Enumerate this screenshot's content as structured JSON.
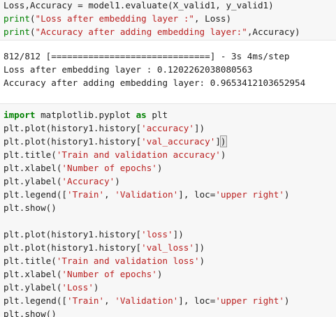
{
  "cell_top": {
    "lines": [
      {
        "segments": [
          {
            "cls": "t-plain",
            "text": "Loss,Accuracy = model1.evaluate(X_valid1, y_valid1)"
          }
        ]
      },
      {
        "segments": [
          {
            "cls": "t-builtin",
            "text": "print"
          },
          {
            "cls": "t-plain",
            "text": "("
          },
          {
            "cls": "t-str",
            "text": "\"Loss after embedding layer :\""
          },
          {
            "cls": "t-plain",
            "text": ", Loss)"
          }
        ]
      },
      {
        "segments": [
          {
            "cls": "t-builtin",
            "text": "print"
          },
          {
            "cls": "t-plain",
            "text": "("
          },
          {
            "cls": "t-str",
            "text": "\"Accuracy after adding embedding layer:\""
          },
          {
            "cls": "t-plain",
            "text": ",Accuracy)"
          }
        ]
      }
    ]
  },
  "output": {
    "lines": [
      "812/812 [==============================] - 3s 4ms/step",
      "Loss after embedding layer : 0.1202262038080563",
      "Accuracy after adding embedding layer: 0.9653412103652954"
    ]
  },
  "cell_plot": {
    "lines": [
      {
        "segments": [
          {
            "cls": "t-kw",
            "text": "import"
          },
          {
            "cls": "t-plain",
            "text": " matplotlib.pyplot "
          },
          {
            "cls": "t-kw",
            "text": "as"
          },
          {
            "cls": "t-plain",
            "text": " plt"
          }
        ]
      },
      {
        "segments": [
          {
            "cls": "t-plain",
            "text": "plt.plot(history1.history["
          },
          {
            "cls": "t-str",
            "text": "'accuracy'"
          },
          {
            "cls": "t-plain",
            "text": "])"
          }
        ]
      },
      {
        "segments": [
          {
            "cls": "t-plain",
            "text": "plt.plot("
          },
          {
            "cls": "t-plain",
            "text": "history1.history["
          },
          {
            "cls": "t-str",
            "text": "'val_accuracy'"
          },
          {
            "cls": "t-plain",
            "text": "]"
          },
          {
            "cls": "bracket",
            "text": ")"
          }
        ]
      },
      {
        "segments": [
          {
            "cls": "t-plain",
            "text": "plt.title("
          },
          {
            "cls": "t-str",
            "text": "'Train and validation accuracy'"
          },
          {
            "cls": "t-plain",
            "text": ")"
          }
        ]
      },
      {
        "segments": [
          {
            "cls": "t-plain",
            "text": "plt.xlabel("
          },
          {
            "cls": "t-str",
            "text": "'Number of epochs'"
          },
          {
            "cls": "t-plain",
            "text": ")"
          }
        ]
      },
      {
        "segments": [
          {
            "cls": "t-plain",
            "text": "plt.ylabel("
          },
          {
            "cls": "t-str",
            "text": "'Accuracy'"
          },
          {
            "cls": "t-plain",
            "text": ")"
          }
        ]
      },
      {
        "segments": [
          {
            "cls": "t-plain",
            "text": "plt.legend(["
          },
          {
            "cls": "t-str",
            "text": "'Train'"
          },
          {
            "cls": "t-plain",
            "text": ", "
          },
          {
            "cls": "t-str",
            "text": "'Validation'"
          },
          {
            "cls": "t-plain",
            "text": "], loc="
          },
          {
            "cls": "t-str",
            "text": "'upper right'"
          },
          {
            "cls": "t-plain",
            "text": ")"
          }
        ]
      },
      {
        "segments": [
          {
            "cls": "t-plain",
            "text": "plt.show()"
          }
        ]
      },
      {
        "segments": [
          {
            "cls": "t-plain",
            "text": ""
          }
        ]
      },
      {
        "segments": [
          {
            "cls": "t-plain",
            "text": "plt.plot(history1.history["
          },
          {
            "cls": "t-str",
            "text": "'loss'"
          },
          {
            "cls": "t-plain",
            "text": "])"
          }
        ]
      },
      {
        "segments": [
          {
            "cls": "t-plain",
            "text": "plt.plot(history1.history["
          },
          {
            "cls": "t-str",
            "text": "'val_loss'"
          },
          {
            "cls": "t-plain",
            "text": "])"
          }
        ]
      },
      {
        "segments": [
          {
            "cls": "t-plain",
            "text": "plt.title("
          },
          {
            "cls": "t-str",
            "text": "'Train and validation loss'"
          },
          {
            "cls": "t-plain",
            "text": ")"
          }
        ]
      },
      {
        "segments": [
          {
            "cls": "t-plain",
            "text": "plt.xlabel("
          },
          {
            "cls": "t-str",
            "text": "'Number of epochs'"
          },
          {
            "cls": "t-plain",
            "text": ")"
          }
        ]
      },
      {
        "segments": [
          {
            "cls": "t-plain",
            "text": "plt.ylabel("
          },
          {
            "cls": "t-str",
            "text": "'Loss'"
          },
          {
            "cls": "t-plain",
            "text": ")"
          }
        ]
      },
      {
        "segments": [
          {
            "cls": "t-plain",
            "text": "plt.legend(["
          },
          {
            "cls": "t-str",
            "text": "'Train'"
          },
          {
            "cls": "t-plain",
            "text": ", "
          },
          {
            "cls": "t-str",
            "text": "'Validation'"
          },
          {
            "cls": "t-plain",
            "text": "], loc="
          },
          {
            "cls": "t-str",
            "text": "'upper right'"
          },
          {
            "cls": "t-plain",
            "text": ")"
          }
        ]
      },
      {
        "segments": [
          {
            "cls": "t-plain",
            "text": "plt.show()"
          }
        ]
      }
    ]
  }
}
